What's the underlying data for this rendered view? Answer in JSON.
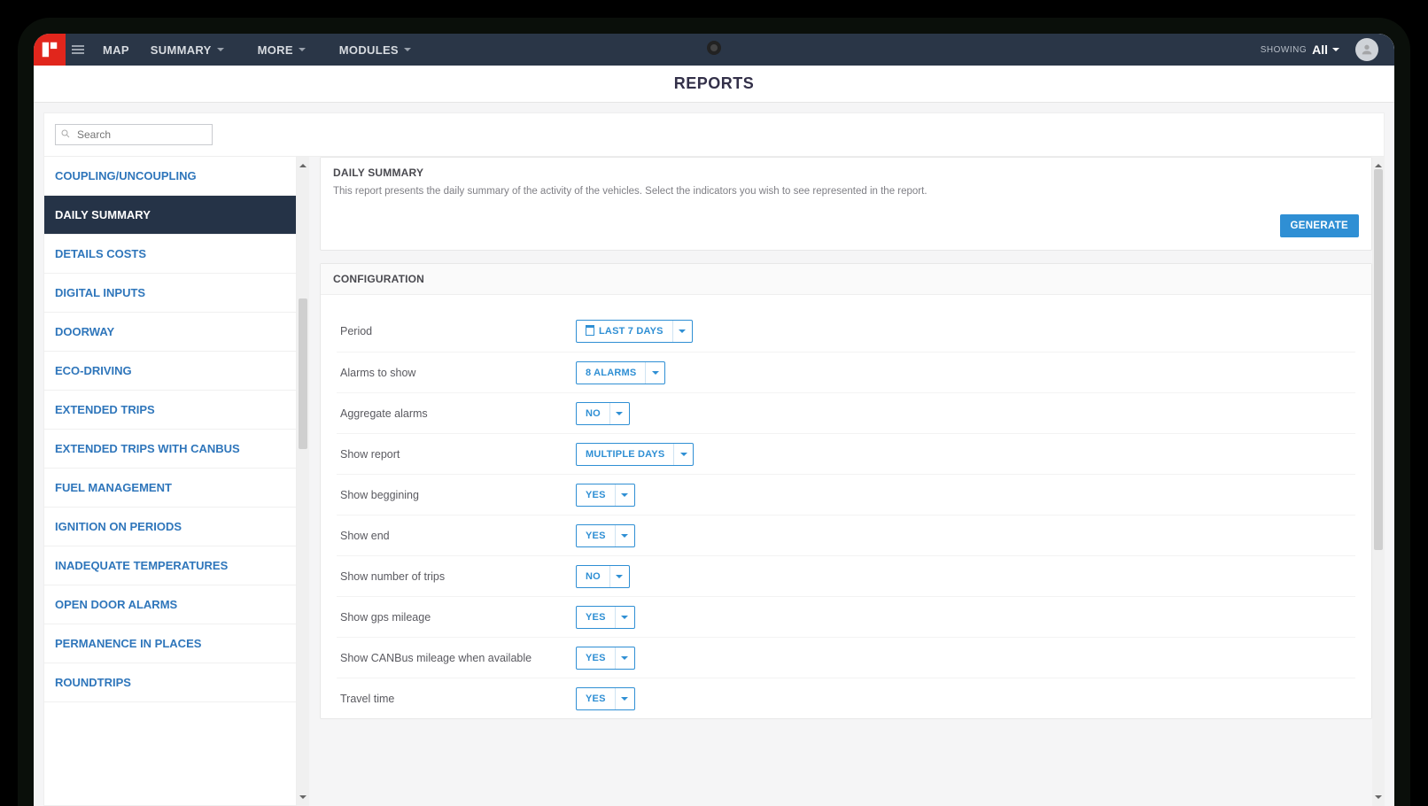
{
  "nav": {
    "map": "MAP",
    "summary": "SUMMARY",
    "more": "MORE",
    "modules": "MODULES",
    "showing_label": "SHOWING",
    "showing_value": "All"
  },
  "page_title": "REPORTS",
  "search_placeholder": "Search",
  "sidebar": {
    "items": [
      "COUPLING/UNCOUPLING",
      "DAILY SUMMARY",
      "DETAILS COSTS",
      "DIGITAL INPUTS",
      "DOORWAY",
      "ECO-DRIVING",
      "EXTENDED TRIPS",
      "EXTENDED TRIPS WITH CANBUS",
      "FUEL MANAGEMENT",
      "IGNITION ON PERIODS",
      "INADEQUATE TEMPERATURES",
      "OPEN DOOR ALARMS",
      "PERMANENCE IN PLACES",
      "ROUNDTRIPS"
    ],
    "active_index": 1
  },
  "summary_panel": {
    "title": "DAILY SUMMARY",
    "description": "This report presents the daily summary of the activity of the vehicles. Select the indicators you wish to see represented in the report.",
    "generate_label": "GENERATE"
  },
  "config_panel": {
    "title": "CONFIGURATION",
    "rows": [
      {
        "label": "Period",
        "value": "LAST 7 DAYS",
        "icon": "calendar"
      },
      {
        "label": "Alarms to show",
        "value": "8 ALARMS"
      },
      {
        "label": "Aggregate alarms",
        "value": "NO"
      },
      {
        "label": "Show report",
        "value": "MULTIPLE DAYS"
      },
      {
        "label": "Show beggining",
        "value": "YES"
      },
      {
        "label": "Show end",
        "value": "YES"
      },
      {
        "label": "Show number of trips",
        "value": "NO"
      },
      {
        "label": "Show gps mileage",
        "value": "YES"
      },
      {
        "label": "Show CANBus mileage when available",
        "value": "YES"
      },
      {
        "label": "Travel time",
        "value": "YES"
      }
    ]
  }
}
